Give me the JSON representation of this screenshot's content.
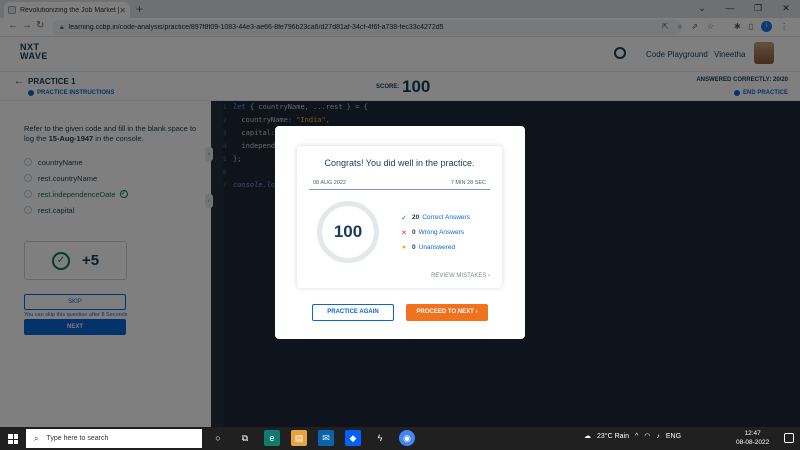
{
  "browser": {
    "tab_title": "Revolutionizing the Job Market |",
    "url": "learning.ccbp.in/code-analysis/practice/897f8f09-1083-44e3-ae66-8fe796b23ca6/d27d81af-34cf-4f6f-a738-fec33c4272d5"
  },
  "header": {
    "logo_line1": "NXT",
    "logo_line2": "WAVE",
    "playground": "Code Playground",
    "username": "Vineetha"
  },
  "practice": {
    "title": "PRACTICE 1",
    "instructions": "PRACTICE INSTRUCTIONS",
    "score_label": "SCORE:",
    "score": "100",
    "answered": "ANSWERED CORRECTLY: 20/20",
    "end": "END PRACTICE"
  },
  "question": {
    "text_pre": "Refer to the given code and fill in the blank space to log the ",
    "text_bold": "15-Aug-1947",
    "text_post": " in the console.",
    "options": [
      "countryName",
      "rest.countryName",
      "rest.independenceDate",
      "rest.capital"
    ],
    "points": "+5",
    "skip": "SKIP",
    "skip_note": "You can skip this question after 8 Seconds",
    "next": "NEXT"
  },
  "code": {
    "line1_kw": "let",
    "line1_rest": " { countryName, ...rest } = {",
    "line2_key": "  countryName: ",
    "line2_val": "\"India\"",
    "line2_end": ",",
    "line3": "  capital:",
    "line4": "  independ",
    "line5": "};",
    "line7": "console.lo"
  },
  "modal": {
    "congrats": "Congrats! You did well in the practice.",
    "date": "08 AUG 2022",
    "duration": "7 MIN 28 SEC",
    "score": "100",
    "correct_count": "20",
    "correct_label": "Correct Answers",
    "wrong_count": "0",
    "wrong_label": "Wrong Answers",
    "unanswered_count": "0",
    "unanswered_label": "Unanswered",
    "review": "REVIEW MISTAKES",
    "practice_again": "PRACTICE AGAIN",
    "proceed": "PROCEED TO NEXT"
  },
  "taskbar": {
    "search_placeholder": "Type here to search",
    "weather": "23°C  Rain",
    "lang": "ENG",
    "time": "12:47",
    "date": "08-08-2022"
  },
  "colors": {
    "accent": "#0967d2",
    "navy": "#183b56",
    "orange": "#f2711c",
    "green": "#047857",
    "editor_bg": "#1f2939"
  }
}
